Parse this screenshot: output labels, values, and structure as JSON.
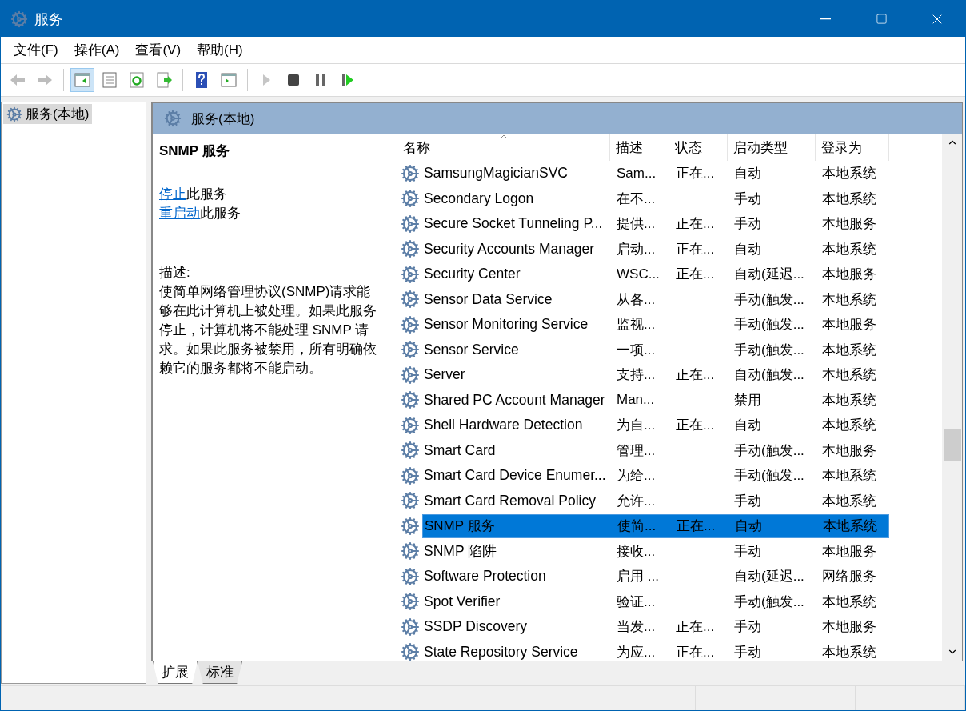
{
  "window": {
    "title": "服务"
  },
  "menu": [
    "文件(F)",
    "操作(A)",
    "查看(V)",
    "帮助(H)"
  ],
  "toolbar": [
    {
      "kind": "back",
      "disabled": true,
      "pressed": false
    },
    {
      "kind": "forward",
      "disabled": true,
      "pressed": false
    },
    {
      "kind": "tree",
      "disabled": false,
      "pressed": true
    },
    {
      "kind": "properties",
      "disabled": false,
      "pressed": false
    },
    {
      "kind": "refresh",
      "disabled": false,
      "pressed": false
    },
    {
      "kind": "export",
      "disabled": false,
      "pressed": false
    },
    {
      "kind": "help",
      "disabled": false,
      "pressed": false
    },
    {
      "kind": "action-pane",
      "disabled": false,
      "pressed": false
    },
    {
      "kind": "start",
      "disabled": true,
      "pressed": false
    },
    {
      "kind": "stop",
      "disabled": false,
      "pressed": false
    },
    {
      "kind": "pause",
      "disabled": false,
      "pressed": false
    },
    {
      "kind": "resume",
      "disabled": false,
      "pressed": false
    }
  ],
  "tree": {
    "items": [
      {
        "label": "服务(本地)",
        "selected": true
      }
    ]
  },
  "pane": {
    "title": "服务(本地)"
  },
  "details": {
    "title": "SNMP 服务",
    "actions": [
      {
        "link": "停止",
        "text": "此服务"
      },
      {
        "link": "重启动",
        "text": "此服务"
      }
    ],
    "description_label": "描述:",
    "description": "使简单网络管理协议(SNMP)请求能够在此计算机上被处理。如果此服务停止，计算机将不能处理 SNMP 请求。如果此服务被禁用，所有明确依赖它的服务都将不能启动。"
  },
  "table": {
    "columns": [
      {
        "label": "名称",
        "sorted": true
      },
      {
        "label": "描述",
        "sorted": false
      },
      {
        "label": "状态",
        "sorted": false
      },
      {
        "label": "启动类型",
        "sorted": false
      },
      {
        "label": "登录为",
        "sorted": false
      }
    ],
    "rows": [
      {
        "name": "SamsungMagicianSVC",
        "description": "Sam...",
        "status": "正在...",
        "startup_type": "自动",
        "log_on_as": "本地系统",
        "selected": false
      },
      {
        "name": "Secondary Logon",
        "description": "在不...",
        "startup_type": "手动",
        "log_on_as": "本地系统",
        "selected": false
      },
      {
        "name": "Secure Socket Tunneling P...",
        "description": "提供...",
        "status": "正在...",
        "startup_type": "手动",
        "log_on_as": "本地服务",
        "selected": false
      },
      {
        "name": "Security Accounts Manager",
        "description": "启动...",
        "status": "正在...",
        "startup_type": "自动",
        "log_on_as": "本地系统",
        "selected": false
      },
      {
        "name": "Security Center",
        "description": "WSC...",
        "status": "正在...",
        "startup_type": "自动(延迟...",
        "log_on_as": "本地服务",
        "selected": false
      },
      {
        "name": "Sensor Data Service",
        "description": "从各...",
        "startup_type": "手动(触发...",
        "log_on_as": "本地系统",
        "selected": false
      },
      {
        "name": "Sensor Monitoring Service",
        "description": "监视...",
        "startup_type": "手动(触发...",
        "log_on_as": "本地服务",
        "selected": false
      },
      {
        "name": "Sensor Service",
        "description": "一项...",
        "startup_type": "手动(触发...",
        "log_on_as": "本地系统",
        "selected": false
      },
      {
        "name": "Server",
        "description": "支持...",
        "status": "正在...",
        "startup_type": "自动(触发...",
        "log_on_as": "本地系统",
        "selected": false
      },
      {
        "name": "Shared PC Account Manager",
        "description": "Man...",
        "startup_type": "禁用",
        "log_on_as": "本地系统",
        "selected": false
      },
      {
        "name": "Shell Hardware Detection",
        "description": "为自...",
        "status": "正在...",
        "startup_type": "自动",
        "log_on_as": "本地系统",
        "selected": false
      },
      {
        "name": "Smart Card",
        "description": "管理...",
        "startup_type": "手动(触发...",
        "log_on_as": "本地服务",
        "selected": false
      },
      {
        "name": "Smart Card Device Enumer...",
        "description": "为给...",
        "startup_type": "手动(触发...",
        "log_on_as": "本地系统",
        "selected": false
      },
      {
        "name": "Smart Card Removal Policy",
        "description": "允许...",
        "startup_type": "手动",
        "log_on_as": "本地系统",
        "selected": false
      },
      {
        "name": "SNMP 服务",
        "description": "使简...",
        "status": "正在...",
        "startup_type": "自动",
        "log_on_as": "本地系统",
        "selected": true
      },
      {
        "name": "SNMP 陷阱",
        "description": "接收...",
        "startup_type": "手动",
        "log_on_as": "本地服务",
        "selected": false
      },
      {
        "name": "Software Protection",
        "description": "启用 ...",
        "startup_type": "自动(延迟...",
        "log_on_as": "网络服务",
        "selected": false
      },
      {
        "name": "Spot Verifier",
        "description": "验证...",
        "startup_type": "手动(触发...",
        "log_on_as": "本地系统",
        "selected": false
      },
      {
        "name": "SSDP Discovery",
        "description": "当发...",
        "status": "正在...",
        "startup_type": "手动",
        "log_on_as": "本地服务",
        "selected": false
      },
      {
        "name": "State Repository Service",
        "description": "为应...",
        "status": "正在...",
        "startup_type": "手动",
        "log_on_as": "本地系统",
        "selected": false
      }
    ]
  },
  "view_tabs": [
    {
      "label": "扩展",
      "selected": true
    },
    {
      "label": "标准",
      "selected": false
    }
  ]
}
